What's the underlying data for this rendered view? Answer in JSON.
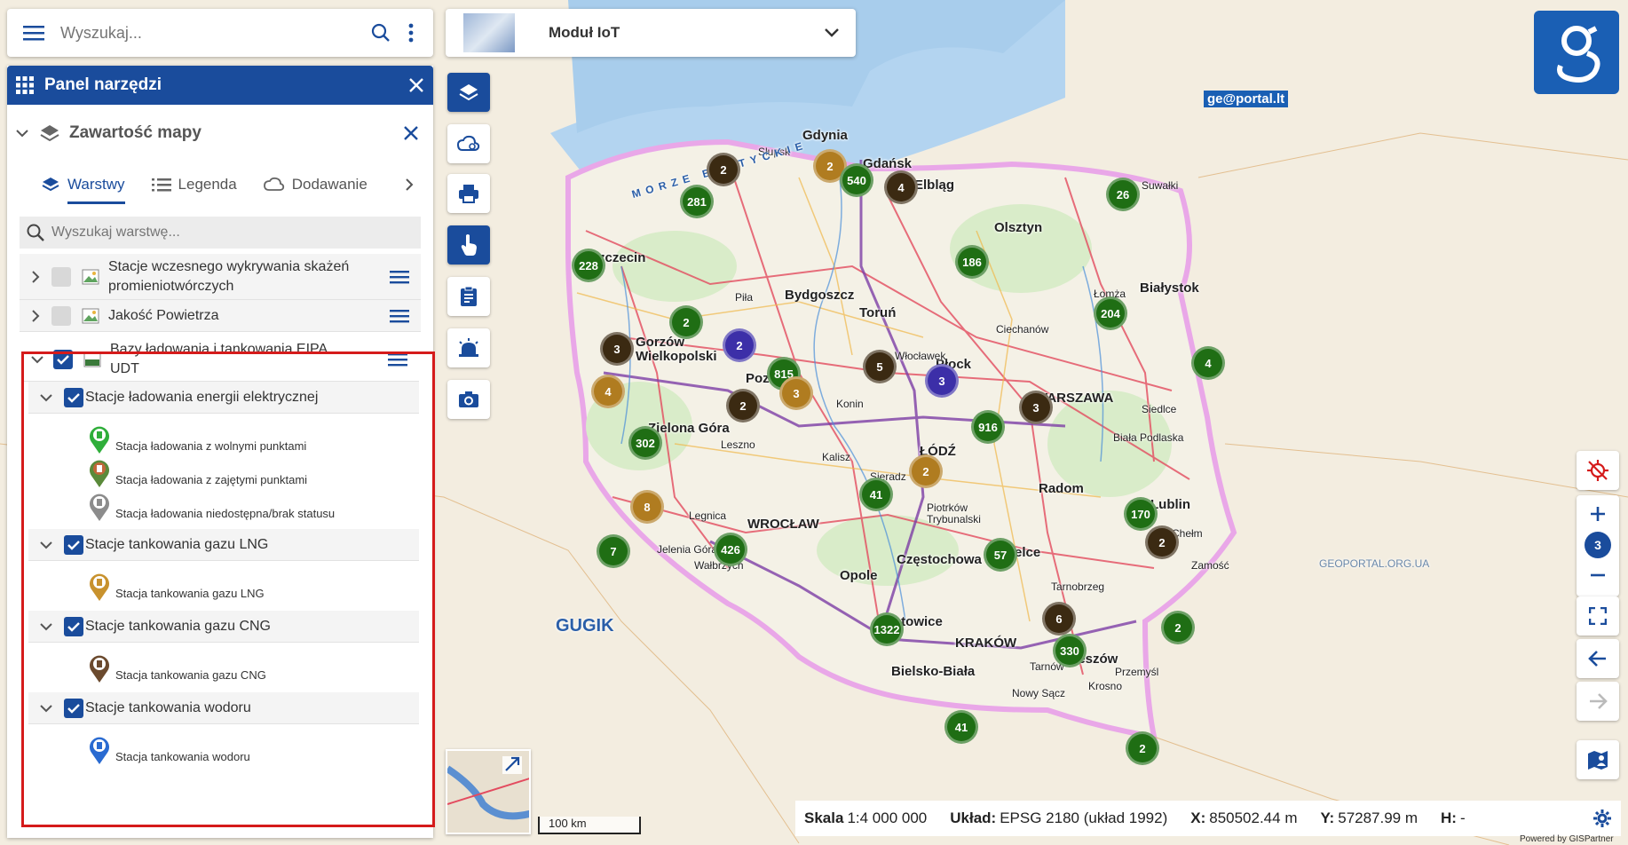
{
  "search": {
    "placeholder": "Wyszukaj..."
  },
  "module": {
    "title": "Moduł IoT"
  },
  "panel": {
    "title": "Panel narzędzi",
    "section_title": "Zawartość mapy",
    "tabs": [
      {
        "label": "Warstwy"
      },
      {
        "label": "Legenda"
      },
      {
        "label": "Dodawanie"
      }
    ],
    "layer_search_placeholder": "Wyszukaj warstwę...",
    "layers": [
      {
        "name_line1": "Stacje wczesnego wykrywania skażeń",
        "name_line2": "promieniotwórczych",
        "checked": false
      },
      {
        "name_line1": "Jakość Powietrza",
        "checked": false
      },
      {
        "name_line1": "Bazy ładowania i tankowania EIPA",
        "name_line2": "UDT",
        "checked": true
      }
    ],
    "sublayers": [
      {
        "name": "Stacje ładowania energii elektrycznej",
        "legend": [
          "Stacja ładowania z wolnymi punktami",
          "Stacja ładowania z zajętymi punktami",
          "Stacja ładowania niedostępna/brak statusu"
        ]
      },
      {
        "name": "Stacje tankowania gazu LNG",
        "legend": [
          "Stacja tankowania gazu LNG"
        ]
      },
      {
        "name": "Stacje tankowania gazu CNG",
        "legend": [
          "Stacja tankowania gazu CNG"
        ]
      },
      {
        "name": "Stacje tankowania wodoru",
        "legend": [
          "Stacja tankowania wodoru"
        ]
      }
    ]
  },
  "map": {
    "labels": {
      "gdynia": "Gdynia",
      "gdansk": "Gdańsk",
      "elblag": "Elbląg",
      "slupsk": "Słupsk",
      "szczecin": "Szczecin",
      "bydgoszcz": "Bydgoszcz",
      "torun": "Toruń",
      "olsztyn": "Olsztyn",
      "bialystok": "Białystok",
      "gorzow": "Gorzów Wielkopolski",
      "poznan": "Poznań",
      "plock": "Płock",
      "warszawa": "WARSZAWA",
      "lodz": "ŁÓDŹ",
      "zgora": "Zielona Góra",
      "wroclaw": "WROCŁAW",
      "opole": "Opole",
      "czestochowa": "Częstochowa",
      "katowice": "Katowice",
      "krakow": "KRAKÓW",
      "rzeszow": "Rzeszów",
      "lublin": "Lublin",
      "radom": "Radom",
      "kielce": "Kielce",
      "bielsko": "Bielsko-Biała",
      "pila": "Piła",
      "lomza": "Łomża",
      "suwalki": "Suwałki",
      "siedlce": "Siedlce",
      "konin": "Konin",
      "kalisz": "Kalisz",
      "legnica": "Legnica",
      "leszno": "Leszno",
      "sieradz": "Sieradz",
      "wloclawek": "Włocławek",
      "ciechanow": "Ciechanów",
      "chelm": "Chełm",
      "zamosc": "Zamość",
      "tarnobrzeg": "Tarnobrzeg",
      "przemysl": "Przemyśl",
      "krosno": "Krosno",
      "tarnow": "Tarnów",
      "nowysacz": "Nowy Sącz",
      "jelenia": "Jelenia Góra",
      "walbrzych": "Wałbrzych",
      "piotrkow": "Piotrków Trybunalski",
      "biala": "Biała Podlaska",
      "morze": "MORZE BAŁTYCKIE",
      "guzk": "GUGIK",
      "geoportal_lt": "ge@portal.lt",
      "geoportal_ua": "GEOPORTAL.ORG.UA"
    },
    "clusters": [
      {
        "v": "2",
        "c": "dark"
      },
      {
        "v": "281",
        "c": "green"
      },
      {
        "v": "2",
        "c": "brown"
      },
      {
        "v": "540",
        "c": "green"
      },
      {
        "v": "4",
        "c": "dark"
      },
      {
        "v": "26",
        "c": "green"
      },
      {
        "v": "228",
        "c": "green"
      },
      {
        "v": "186",
        "c": "green"
      },
      {
        "v": "204",
        "c": "green"
      },
      {
        "v": "2",
        "c": "green"
      },
      {
        "v": "3",
        "c": "dark"
      },
      {
        "v": "2",
        "c": "blue"
      },
      {
        "v": "815",
        "c": "green"
      },
      {
        "v": "5",
        "c": "dark"
      },
      {
        "v": "3",
        "c": "blue"
      },
      {
        "v": "4",
        "c": "green"
      },
      {
        "v": "4",
        "c": "brown"
      },
      {
        "v": "2",
        "c": "dark"
      },
      {
        "v": "3",
        "c": "brown"
      },
      {
        "v": "3",
        "c": "dark"
      },
      {
        "v": "916",
        "c": "green"
      },
      {
        "v": "302",
        "c": "green"
      },
      {
        "v": "2",
        "c": "brown"
      },
      {
        "v": "41",
        "c": "green"
      },
      {
        "v": "8",
        "c": "brown"
      },
      {
        "v": "170",
        "c": "green"
      },
      {
        "v": "2",
        "c": "dark"
      },
      {
        "v": "7",
        "c": "green"
      },
      {
        "v": "426",
        "c": "green"
      },
      {
        "v": "57",
        "c": "green"
      },
      {
        "v": "6",
        "c": "dark"
      },
      {
        "v": "1322",
        "c": "green"
      },
      {
        "v": "330",
        "c": "green"
      },
      {
        "v": "2",
        "c": "green"
      },
      {
        "v": "41",
        "c": "green"
      },
      {
        "v": "2",
        "c": "green"
      }
    ]
  },
  "zoom": {
    "level": "3"
  },
  "scale": {
    "label": "100 km"
  },
  "status": {
    "scale_label": "Skala",
    "scale_value": "1:4 000 000",
    "crs_label": "Układ:",
    "crs_value": "EPSG 2180 (układ 1992)",
    "x_label": "X:",
    "x_value": "850502.44 m",
    "y_label": "Y:",
    "y_value": "57287.99 m",
    "h_label": "H:",
    "h_value": "-"
  },
  "powered_by": "Powered by GISPartner",
  "colors": {
    "primary": "#1a4c9c",
    "highlight": "#d51b1b",
    "cluster_green": "#1f6e14",
    "cluster_brown": "#b07c20",
    "cluster_dark": "#3b2a12",
    "cluster_blue": "#3c2fa8"
  }
}
